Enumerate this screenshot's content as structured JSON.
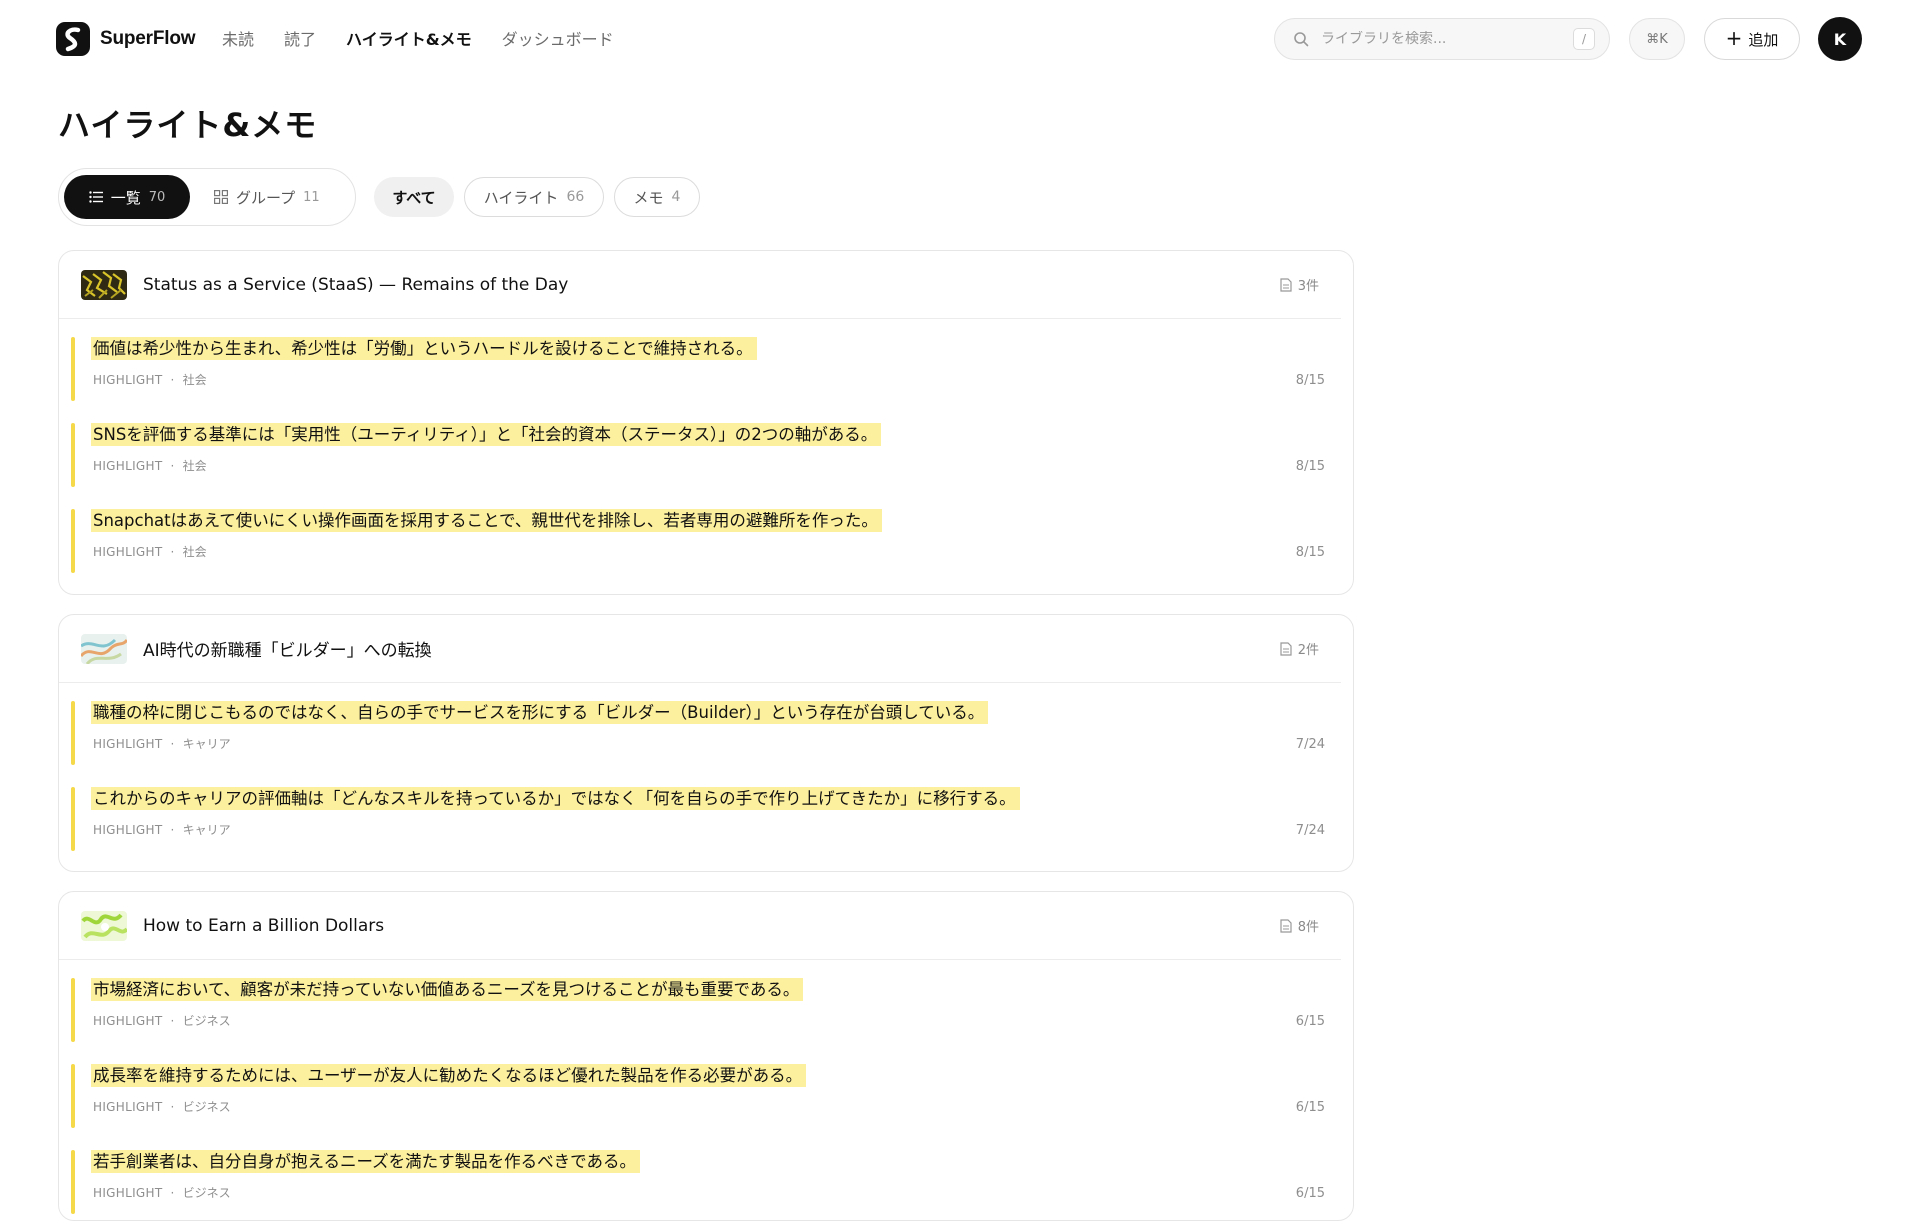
{
  "app": {
    "name": "SuperFlow"
  },
  "nav": [
    "未読",
    "読了",
    "ハイライト&メモ",
    "ダッシュボード"
  ],
  "search": {
    "placeholder": "ライブラリを検索...",
    "shortcut": "/"
  },
  "command": {
    "label": "⌘K"
  },
  "add_button": {
    "label": "追加"
  },
  "avatar": {
    "initial": "K"
  },
  "page_title": "ハイライト&メモ",
  "view_toggle": {
    "list": {
      "label": "一覧",
      "count": "70"
    },
    "group": {
      "label": "グループ",
      "count": "11"
    }
  },
  "filters": {
    "all": {
      "label": "すべて"
    },
    "highlight": {
      "label": "ハイライト",
      "count": "66"
    },
    "memo": {
      "label": "メモ",
      "count": "4"
    }
  },
  "cards": [
    {
      "title": "Status as a Service (StaaS) — Remains of the Day",
      "count": "3件",
      "highlights": [
        {
          "text": "価値は希少性から生まれ、希少性は「労働」というハードルを設けることで維持される。",
          "type": "HIGHLIGHT",
          "tag": "社会",
          "date": "8/15"
        },
        {
          "text": "SNSを評価する基準には「実用性（ユーティリティ）」と「社会的資本（ステータス）」の2つの軸がある。",
          "type": "HIGHLIGHT",
          "tag": "社会",
          "date": "8/15"
        },
        {
          "text": "Snapchatはあえて使いにくい操作画面を採用することで、親世代を排除し、若者専用の避難所を作った。",
          "type": "HIGHLIGHT",
          "tag": "社会",
          "date": "8/15"
        }
      ]
    },
    {
      "title": "AI時代の新職種「ビルダー」への転換",
      "count": "2件",
      "highlights": [
        {
          "text": "職種の枠に閉じこもるのではなく、自らの手でサービスを形にする「ビルダー（Builder）」という存在が台頭している。",
          "type": "HIGHLIGHT",
          "tag": "キャリア",
          "date": "7/24"
        },
        {
          "text": "これからのキャリアの評価軸は「どんなスキルを持っているか」ではなく「何を自らの手で作り上げてきたか」に移行する。",
          "type": "HIGHLIGHT",
          "tag": "キャリア",
          "date": "7/24"
        }
      ]
    },
    {
      "title": "How to Earn a Billion Dollars",
      "count": "8件",
      "highlights": [
        {
          "text": "市場経済において、顧客が未だ持っていない価値あるニーズを見つけることが最も重要である。",
          "type": "HIGHLIGHT",
          "tag": "ビジネス",
          "date": "6/15"
        },
        {
          "text": "成長率を維持するためには、ユーザーが友人に勧めたくなるほど優れた製品を作る必要がある。",
          "type": "HIGHLIGHT",
          "tag": "ビジネス",
          "date": "6/15"
        },
        {
          "text": "若手創業者は、自分自身が抱えるニーズを満たす製品を作るべきである。",
          "type": "HIGHLIGHT",
          "tag": "ビジネス",
          "date": "6/15"
        }
      ]
    }
  ],
  "colors": {
    "highlight_bg": "#fcef9e",
    "highlight_bar": "#f5d94a",
    "accent": "#111111"
  },
  "icons": {
    "search": "search-icon",
    "list": "list-icon",
    "grid": "grid-icon",
    "doc": "document-icon",
    "plus": "plus-icon"
  }
}
